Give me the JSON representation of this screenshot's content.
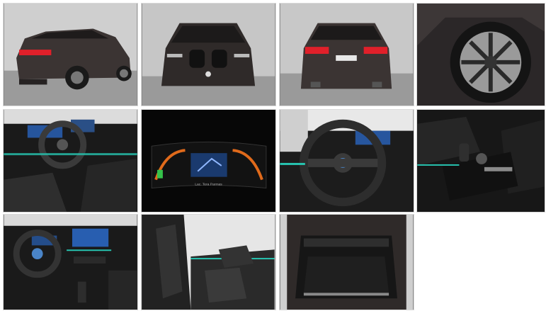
{
  "gallery": {
    "photos": [
      {
        "subject": "rear three-quarter exterior",
        "dashboard_text": ""
      },
      {
        "subject": "front exterior",
        "dashboard_text": ""
      },
      {
        "subject": "rear exterior",
        "dashboard_text": ""
      },
      {
        "subject": "wheel close-up",
        "dashboard_text": ""
      },
      {
        "subject": "interior driver cockpit",
        "dashboard_text": ""
      },
      {
        "subject": "digital instrument cluster",
        "dashboard_text": "Lac. Tera Parmas"
      },
      {
        "subject": "steering wheel",
        "dashboard_text": ""
      },
      {
        "subject": "center console gear selector",
        "dashboard_text": ""
      },
      {
        "subject": "dashboard with infotainment screen",
        "dashboard_text": ""
      },
      {
        "subject": "front seats side view",
        "dashboard_text": ""
      },
      {
        "subject": "open trunk cargo area",
        "dashboard_text": ""
      }
    ]
  },
  "colors": {
    "car_body": "#3b3433",
    "showroom_wall": "#c9c9c9",
    "showroom_floor": "#9a9a9a",
    "interior_dark": "#1a1a1a",
    "ambient_light": "#27c4b0",
    "taillight": "#e0202a",
    "cluster_blue": "#2c6fd6"
  }
}
